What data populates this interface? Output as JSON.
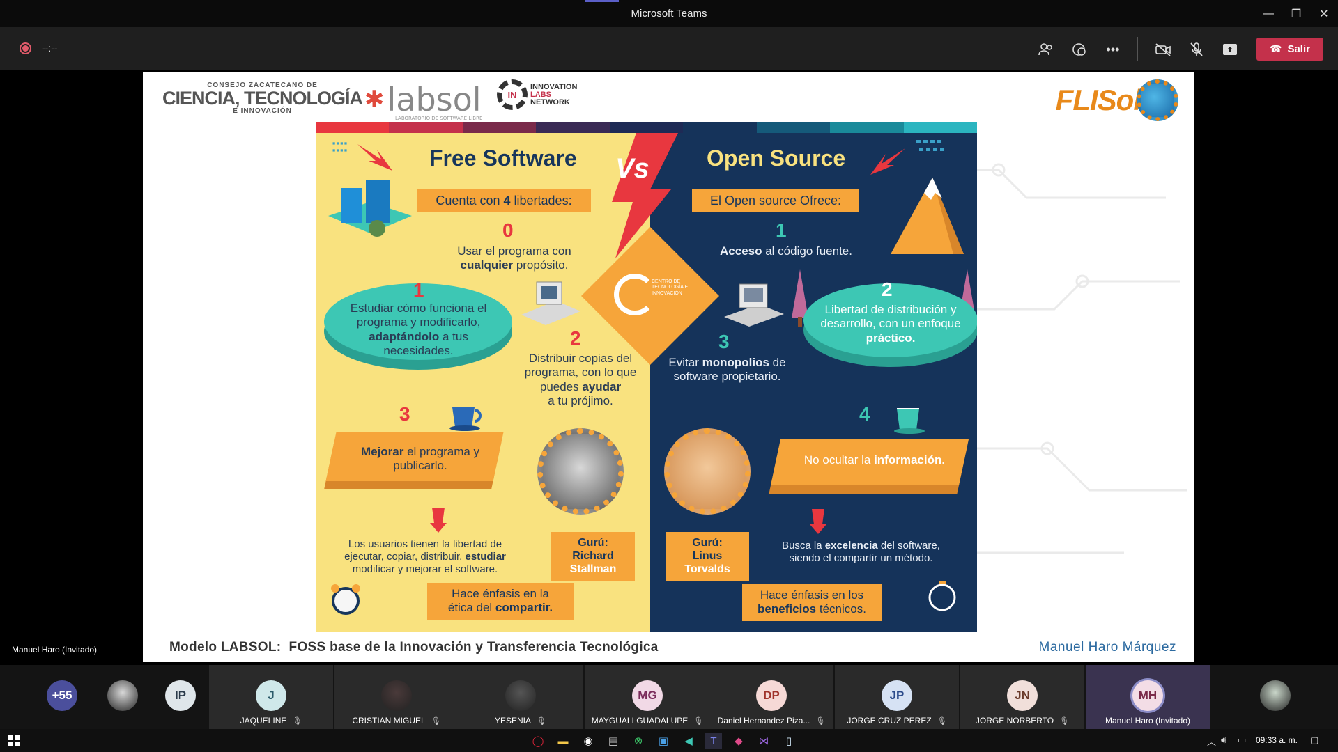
{
  "window": {
    "title": "Microsoft Teams",
    "min": "—",
    "restore": "❐",
    "close": "✕"
  },
  "meeting": {
    "timer": "--:--",
    "leave_label": "Salir",
    "toolbar_icons": [
      "participants-icon",
      "chat-icon",
      "more-icon",
      "camera-off-icon",
      "mic-off-icon",
      "share-icon"
    ]
  },
  "slide": {
    "logos": {
      "czcti_small_top": "CONSEJO ZACATECANO DE",
      "czcti_big": "CIENCIA, TECNOLOGÍA",
      "czcti_small_bottom": "E INNOVACIÓN",
      "labsol": "labsol",
      "labsol_sub": "LABORATORIO DE SOFTWARE LIBRE",
      "iln_gear": "IN",
      "iln_line1": "INNOVATION",
      "iln_line2": "LABS",
      "iln_line3": "NETWORK",
      "flisol": "FLISol"
    },
    "infographic": {
      "free": {
        "title": "Free Software",
        "ribbon_pre": "Cuenta con ",
        "ribbon_bold": "4",
        "ribbon_post": " libertades:",
        "items": [
          {
            "num": "0",
            "pre": "Usar el programa con",
            "bold": "cualquier",
            "post": " propósito."
          },
          {
            "num": "1",
            "pre": "Estudiar cómo funciona el programa y modificarlo,",
            "bold": "adaptándolo",
            "post": " a tus necesidades."
          },
          {
            "num": "2",
            "pre": "Distribuir copias del programa, con lo que puedes",
            "bold": "ayudar",
            "post": "a tu prójimo."
          },
          {
            "num": "3",
            "pre": "",
            "bold": "Mejorar",
            "post": " el programa y publicarlo."
          }
        ],
        "users_pre": "Los usuarios tienen la libertad de ejecutar, copiar, distribuir, ",
        "users_bold": "estudiar",
        "users_post": " modificar y mejorar el software.",
        "guru_label": "Gurú:",
        "guru_name1": "Richard",
        "guru_name2": "Stallman",
        "emph_pre": "Hace énfasis en la",
        "emph_mid": "ética del ",
        "emph_bold": "compartir."
      },
      "vs": "Vs",
      "center_logo_text": "CENTRO DE TECNOLOGÍA E INNOVACIÓN",
      "open": {
        "title": "Open Source",
        "ribbon": "El Open source Ofrece:",
        "items": [
          {
            "num": "1",
            "bold": "Acceso",
            "post": " al código fuente."
          },
          {
            "num": "2",
            "pre": "Libertad de distribución y desarrollo, con un enfoque ",
            "bold": "práctico."
          },
          {
            "num": "3",
            "pre": "Evitar ",
            "bold": "monopolios",
            "post": " de software propietario."
          },
          {
            "num": "4",
            "pre": "No ocultar la ",
            "bold": "información."
          }
        ],
        "seek_pre": "Busca la ",
        "seek_bold": "excelencia",
        "seek_post": " del software, siendo el compartir un método.",
        "guru_label": "Gurú:",
        "guru_name1": "Linus",
        "guru_name2": "Torvalds",
        "emph_pre": "Hace énfasis en los",
        "emph_bold": "beneficios",
        "emph_post": " técnicos."
      },
      "stripe_colors": [
        "#e8373f",
        "#c4314b",
        "#7a2a4a",
        "#3a2a55",
        "#1e2a55",
        "#15335a",
        "#155a7a",
        "#1a8a9a",
        "#2bb5c0"
      ]
    },
    "footer_left": "Modelo LABSOL:  FOSS base de la Innovación y Transferencia Tecnológica",
    "footer_right": "Manuel Haro Márquez"
  },
  "active_speaker": "Manuel Haro (Invitado)",
  "participants": [
    {
      "initials": "+55",
      "name": "",
      "color": "#4b4f9c",
      "fg": "#fff"
    },
    {
      "initials": "",
      "name": "",
      "color": "#d8d8d8",
      "fg": "#222",
      "photo": true
    },
    {
      "initials": "IP",
      "name": "",
      "color": "#dfe6ea",
      "fg": "#2a3a4a"
    },
    {
      "initials": "J",
      "name": "JAQUELINE",
      "color": "#cfe8ea",
      "fg": "#2a5a6a"
    },
    {
      "initials": "",
      "name": "CRISTIAN MIGUEL",
      "color": "#4a3a3a",
      "fg": "#fff",
      "photo": true
    },
    {
      "initials": "",
      "name": "YESENIA",
      "color": "#555",
      "fg": "#fff",
      "photo": true
    },
    {
      "initials": "MG",
      "name": "MAYGUALI GUADALUPE",
      "color": "#f1d9e6",
      "fg": "#7a2a5a"
    },
    {
      "initials": "DP",
      "name": "Daniel Hernandez Piza...",
      "color": "#f6d9d6",
      "fg": "#a0322a"
    },
    {
      "initials": "JP",
      "name": "JORGE CRUZ PEREZ",
      "color": "#d6e2f4",
      "fg": "#2a4a8a"
    },
    {
      "initials": "JN",
      "name": "JORGE NORBERTO",
      "color": "#f1dfda",
      "fg": "#6a3a2a"
    },
    {
      "initials": "MH",
      "name": "Manuel Haro (Invitado)",
      "color": "#f3dde6",
      "fg": "#7a2a4a"
    },
    {
      "initials": "",
      "name": "",
      "color": "#c9d6c9",
      "fg": "#222",
      "photo": true
    }
  ],
  "taskbar": {
    "clock": "09:33 a. m."
  }
}
